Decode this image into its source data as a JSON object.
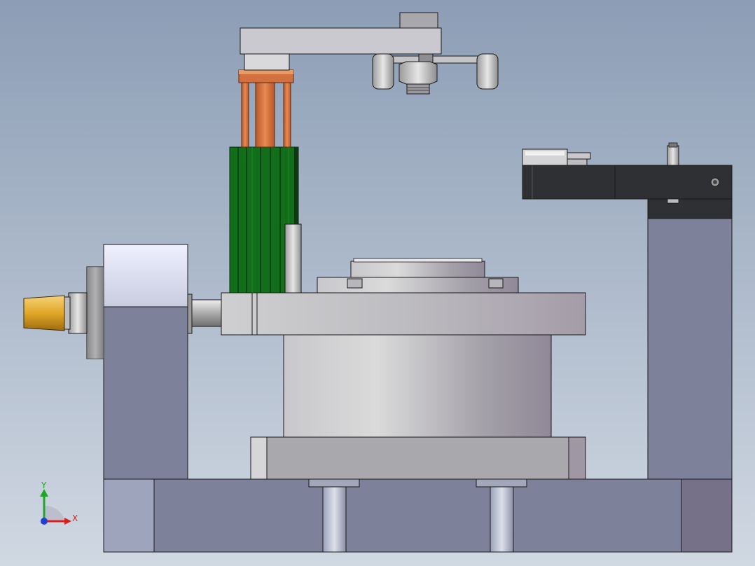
{
  "viewport": {
    "background_top": "#8c9db5",
    "background_bottom": "#d0d8e2"
  },
  "triad": {
    "x_label": "X",
    "y_label": "Y",
    "x_color": "#d62020",
    "y_color": "#1fa62a",
    "z_color": "#1f3fd6"
  },
  "colors": {
    "copper": "#d2713f",
    "green_block": "#126e1a",
    "brass": "#e3ac2a",
    "dark_bracket": "#2f3033",
    "base_grey": "#7d8199",
    "light_grey": "#c9c9cf"
  },
  "model": {
    "components": [
      "base-plate",
      "rotary-table",
      "motor-cylinder",
      "left-support",
      "nozzle",
      "green-clamp-block",
      "copper-rods",
      "top-arm",
      "gripper-assembly",
      "right-column",
      "right-bracket",
      "bracket-gauge"
    ]
  }
}
